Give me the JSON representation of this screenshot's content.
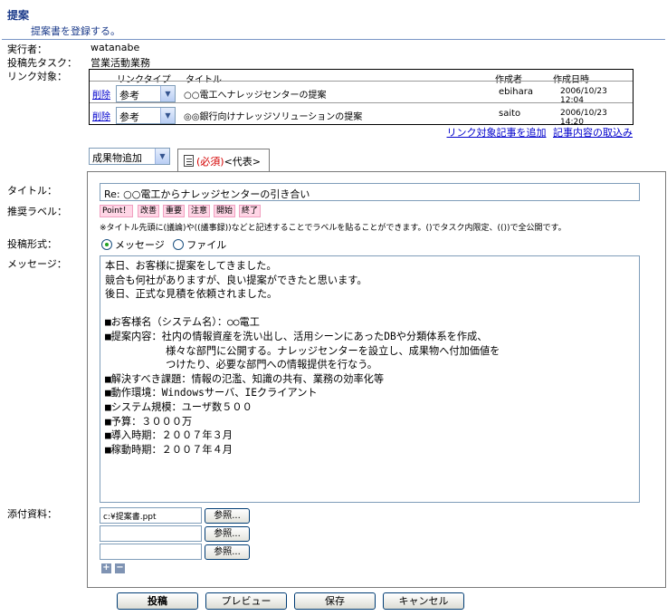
{
  "header": {
    "title": "提案",
    "subtitle": "提案書を登録する。"
  },
  "info": {
    "executor_label": "実行者：",
    "executor_value": "watanabe",
    "task_label": "投稿先タスク：",
    "task_value": "営業活動業務",
    "link_label": "リンク対象："
  },
  "link_table": {
    "headers": {
      "type": "リンクタイプ",
      "title": "タイトル",
      "author": "作成者",
      "date": "作成日時"
    },
    "rows": [
      {
        "delete": "削除",
        "type": "参考",
        "title": "○○電工へナレッジセンターの提案",
        "author": "ebihara",
        "date": "2006/10/23 12:04"
      },
      {
        "delete": "削除",
        "type": "参考",
        "title": "◎◎銀行向けナレッジソリューションの提案",
        "author": "saito",
        "date": "2006/10/23 14:20"
      }
    ],
    "add_link": "リンク対象記事を追加",
    "import_content": "記事内容の取込み"
  },
  "artifact_select": "成果物追加",
  "tab": {
    "required": "(必須)",
    "label": "<代表>"
  },
  "form": {
    "title_label": "タイトル：",
    "title_value": "Re: ○○電工からナレッジセンターの引き合い",
    "labels_label": "推奨ラベル：",
    "chips": [
      "Point！",
      "改善",
      "重要",
      "注意",
      "開始",
      "終了"
    ],
    "note": "※タイトル先頭に(議論)や((議事録))などと記述することでラベルを貼ることができます。()でタスク内限定、(())で全公開です。",
    "post_type_label": "投稿形式：",
    "post_type_message": "メッセージ",
    "post_type_file": "ファイル",
    "message_label": "メッセージ：",
    "message_lines": [
      "本日、お客様に提案をしてきました。",
      "競合も何社がありますが、良い提案ができたと思います。",
      "後日、正式な見積を依頼されました。",
      "",
      "■お客様名（システム名）：○○電工",
      "■提案内容：社内の情報資産を洗い出し、活用シーンにあったDBや分類体系を作成、",
      "　　　　　　様々な部門に公開する。ナレッジセンターを設立し、成果物へ付加価値を",
      "　　　　　　つけたり、必要な部門への情報提供を行なう。",
      "■解決すべき課題：情報の氾濫、知識の共有、業務の効率化等",
      "■動作環境：Windowsサーバ、IEクライアント",
      "■システム規模：ユーザ数５００",
      "■予算：３０００万",
      "■導入時期：２００７年３月",
      "■稼動時期：２００７年４月"
    ],
    "attach_label": "添付資料：",
    "attachments": [
      "c:¥提案書.ppt",
      "",
      ""
    ],
    "browse_label": "参照..."
  },
  "buttons": {
    "post": "投稿",
    "preview": "プレビュー",
    "save": "保存",
    "cancel": "キャンセル"
  }
}
